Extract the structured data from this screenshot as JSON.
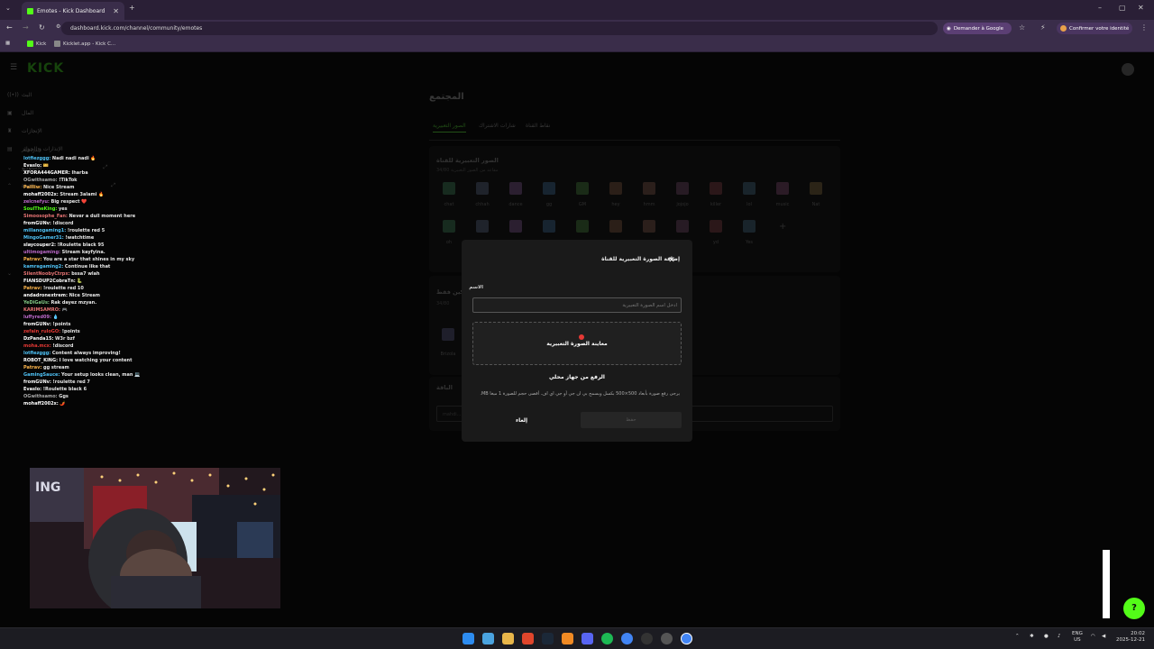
{
  "browser": {
    "tab_title": "Emotes - Kick Dashboard",
    "url": "dashboard.kick.com/channel/community/emotes",
    "google_button": "Demander à Google",
    "identity_button": "Confirmer votre identité",
    "bookmarks": [
      "Kick",
      "Kicklet.app - Kick C..."
    ]
  },
  "sidebar": {
    "logo": "KICK",
    "items": [
      "البث",
      "المال",
      "الإنجازات",
      "الإنذارات و الجوائز",
      "الاستوديو",
      "القناة"
    ],
    "submenu_label": "الدردشة"
  },
  "chat": [
    {
      "user": "lotfiezggg:",
      "msg": "Nadi nadi nadi 🔥",
      "color": "#4fc3f7"
    },
    {
      "user": "Evaslo:",
      "msg": "🎫",
      "color": "#ffffff"
    },
    {
      "user": "XFORA444GAMER:",
      "msg": "lharba",
      "color": "#ffffff"
    },
    {
      "user": "OGwithsamo:",
      "msg": "!TikTok",
      "color": "#aaaaaa"
    },
    {
      "user": "Pallliw:",
      "msg": "Nice Stream",
      "color": "#ffb74d"
    },
    {
      "user": "mohaff2002x:",
      "msg": "Stream 3alami 🔥",
      "color": "#ffffff"
    },
    {
      "user": "zelcnefyu:",
      "msg": "Big respect ❤️",
      "color": "#ba68c8"
    },
    {
      "user": "SoulTheKing:",
      "msg": "yes",
      "color": "#53fc18"
    },
    {
      "user": "Simoosophe_Fan:",
      "msg": "Never a dull moment here",
      "color": "#e57373"
    },
    {
      "user": "fromGUNv:",
      "msg": "!discord",
      "color": "#ffffff"
    },
    {
      "user": "millanogaming1:",
      "msg": "!roulette red 5",
      "color": "#4fc3f7"
    },
    {
      "user": "MingoGamer31:",
      "msg": "!watchtime",
      "color": "#4fc3f7"
    },
    {
      "user": "slaycouper2:",
      "msg": "!Roulette black 95",
      "color": "#ffffff"
    },
    {
      "user": "ultimogaming:",
      "msg": "Stream kayfyina.",
      "color": "#ba68c8"
    },
    {
      "user": "Patrav:",
      "msg": "You are a star that shines in my sky",
      "color": "#ffb74d"
    },
    {
      "user": "kamragaming2:",
      "msg": "Continue like that",
      "color": "#4fc3f7"
    },
    {
      "user": "SilentNoobyCtrpx:",
      "msg": "bssa7 wlah",
      "color": "#e57373"
    },
    {
      "user": "FIANSDUP2CobraTn:",
      "msg": "🐍",
      "color": "#ffffff"
    },
    {
      "user": "Patrav:",
      "msg": "!roulette red 10",
      "color": "#ffb74d"
    },
    {
      "user": "andadronextrem:",
      "msg": "Nice Stream",
      "color": "#ffffff"
    },
    {
      "user": "YeDiGaUs:",
      "msg": "Rak dayez mzyan.",
      "color": "#81c784"
    },
    {
      "user": "KARIMSAMRO:",
      "msg": "🎮",
      "color": "#e57373"
    },
    {
      "user": "luffyred09:",
      "msg": "💧",
      "color": "#ba68c8"
    },
    {
      "user": "fromGUNv:",
      "msg": "!points",
      "color": "#ffffff"
    },
    {
      "user": "zefain_ruloGO:",
      "msg": "!points",
      "color": "#e53935"
    },
    {
      "user": "DzPanda15:",
      "msg": "W3r bzf",
      "color": "#ffffff"
    },
    {
      "user": "moha.mcx:",
      "msg": "!discord",
      "color": "#e53935"
    },
    {
      "user": "lotfiezggg:",
      "msg": "Content always improving!",
      "color": "#4fc3f7"
    },
    {
      "user": "ROBOT_KING:",
      "msg": "I love watching your content",
      "color": "#ffffff"
    },
    {
      "user": "Patrav:",
      "msg": "gg stream",
      "color": "#ffb74d"
    },
    {
      "user": "GamingSauce:",
      "msg": "Your setup looks clean, man 💻",
      "color": "#4fc3f7"
    },
    {
      "user": "fromGUNv:",
      "msg": "!roulette red 7",
      "color": "#ffffff"
    },
    {
      "user": "Evaslo:",
      "msg": "!Roulette black 6",
      "color": "#ffffff"
    },
    {
      "user": "OGwithsamo:",
      "msg": "Ggs",
      "color": "#aaaaaa"
    },
    {
      "user": "mohaff2002x:",
      "msg": "🌶️",
      "color": "#ffffff"
    }
  ],
  "dashboard": {
    "page_title": "المجتمع",
    "tabs": [
      "الصور التعبيرية",
      "شارات الاشتراك",
      "نقاط القناة"
    ],
    "channel_emotes_title": "الصور التعبيرية للقناة",
    "channel_emotes_count": "34/80 مقاعد من الصور التعبيرية",
    "emotes_row1": [
      "chat",
      "chhah",
      "dance",
      "gg",
      "GM",
      "hey",
      "hmm",
      "jojojo",
      "killer",
      "lol",
      "music",
      "Nat"
    ],
    "emotes_row2": [
      "oh",
      "",
      "",
      "",
      "",
      "",
      "",
      "",
      "yd",
      "Yes"
    ],
    "subs_title": "للمشتركين فقط",
    "subs_count": "34/80",
    "subs_emote": "Brizola",
    "blocked_title": "الباقة",
    "blocked_input": "mahdi..."
  },
  "modal": {
    "title": "إضافة الصورة التعبيرية للقناة",
    "name_label": "الاسم",
    "name_placeholder": "أدخل اسم الصورة التعبيرية",
    "dropzone_label": "معاينة الصورة التعبيرية",
    "upload_label": "الرفع من جهاز محلي",
    "hint": "يرجى رفع صورة بأبعاد 500×500 بكسل ويسمح بي ان جي أو جي اي اف. أقصى حجم للصورة 1 ميغا MB.",
    "cancel_label": "إلغاء",
    "save_label": "حفظ"
  },
  "taskbar": {
    "lang": "ENG",
    "region": "US",
    "time": "20:02",
    "date": "2025-12-21"
  }
}
